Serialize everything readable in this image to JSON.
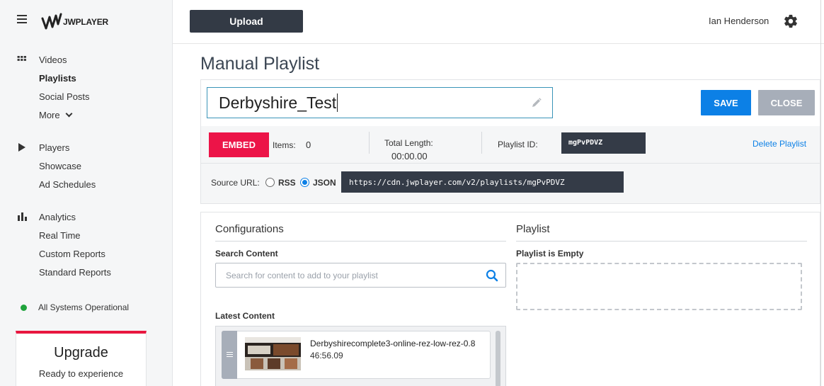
{
  "sidebar": {
    "logo_text": "JWPLAYER",
    "groups": [
      {
        "icon": "grid-icon",
        "items": [
          "Videos",
          "Playlists",
          "Social Posts",
          "More"
        ]
      },
      {
        "icon": "play-icon",
        "items": [
          "Players",
          "Showcase",
          "Ad Schedules"
        ]
      },
      {
        "icon": "bar-chart-icon",
        "items": [
          "Analytics",
          "Real Time",
          "Custom Reports",
          "Standard Reports"
        ]
      }
    ],
    "videos": "Videos",
    "playlists": "Playlists",
    "social_posts": "Social Posts",
    "more": "More",
    "players": "Players",
    "showcase": "Showcase",
    "ad_schedules": "Ad Schedules",
    "analytics": "Analytics",
    "real_time": "Real Time",
    "custom_reports": "Custom Reports",
    "standard_reports": "Standard Reports",
    "active_item": "Playlists",
    "status": "All Systems Operational",
    "status_color": "#1fa33b",
    "upgrade_title": "Upgrade",
    "upgrade_text": "Ready to experience"
  },
  "header": {
    "upload_label": "Upload",
    "user_name": "Ian Henderson"
  },
  "main": {
    "page_title": "Manual Playlist",
    "playlist_title": "Derbyshire_Test",
    "save_label": "SAVE",
    "close_label": "CLOSE",
    "embed_label": "EMBED",
    "items_label": "Items:",
    "items_count": "0",
    "total_length_label": "Total Length:",
    "total_length": "00:00.00",
    "playlist_id_label": "Playlist ID:",
    "playlist_id": "mgPvPDVZ",
    "delete_label": "Delete Playlist",
    "source_url_label": "Source URL:",
    "rss_label": "RSS",
    "json_label": "JSON",
    "selected_format": "JSON",
    "source_url": "https://cdn.jwplayer.com/v2/playlists/mgPvPDVZ"
  },
  "configurations": {
    "title": "Configurations",
    "search_label": "Search Content",
    "search_placeholder": "Search for content to add to your playlist",
    "latest_label": "Latest Content",
    "items": [
      {
        "title": "Derbyshirecomplete3-online-rez-low-rez-0.8",
        "duration": "46:56.09"
      }
    ]
  },
  "playlist": {
    "title": "Playlist",
    "empty_label": "Playlist is Empty"
  },
  "colors": {
    "accent_blue": "#0c80e6",
    "embed_red": "#ec1448",
    "dark": "#333a45",
    "close_gray": "#a7aeb9"
  }
}
